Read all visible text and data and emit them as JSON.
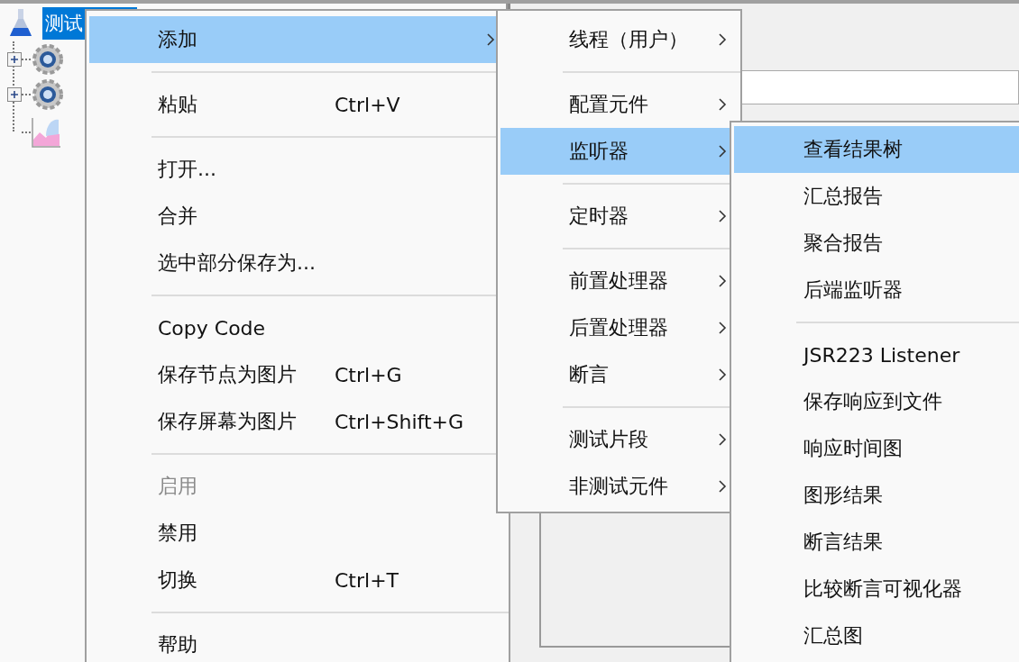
{
  "tree": {
    "root": {
      "label": "测试",
      "selected": true,
      "children": [
        {
          "kind": "gear",
          "expanded": false
        },
        {
          "kind": "gear",
          "expanded": false
        },
        {
          "kind": "chart"
        }
      ]
    }
  },
  "menus": [
    {
      "items": [
        {
          "kind": "item",
          "label": "添加",
          "submenu": true,
          "selected": true
        },
        {
          "kind": "separator"
        },
        {
          "kind": "item",
          "label": "粘贴",
          "shortcut": "Ctrl+V",
          "selected": false
        },
        {
          "kind": "separator"
        },
        {
          "kind": "item",
          "label": "打开...",
          "selected": false
        },
        {
          "kind": "item",
          "label": "合并",
          "selected": false
        },
        {
          "kind": "item",
          "label": "选中部分保存为...",
          "selected": false
        },
        {
          "kind": "separator"
        },
        {
          "kind": "item",
          "label": "Copy Code",
          "selected": false
        },
        {
          "kind": "item",
          "label": "保存节点为图片",
          "shortcut": "Ctrl+G",
          "selected": false
        },
        {
          "kind": "item",
          "label": "保存屏幕为图片",
          "shortcut": "Ctrl+Shift+G",
          "selected": false
        },
        {
          "kind": "separator"
        },
        {
          "kind": "item",
          "label": "启用",
          "disabled": true,
          "selected": false
        },
        {
          "kind": "item",
          "label": "禁用",
          "selected": false
        },
        {
          "kind": "item",
          "label": "切换",
          "shortcut": "Ctrl+T",
          "selected": false
        },
        {
          "kind": "separator"
        },
        {
          "kind": "item",
          "label": "帮助",
          "selected": false
        }
      ]
    },
    {
      "items": [
        {
          "kind": "item",
          "label": "线程（用户）",
          "submenu": true,
          "selected": false
        },
        {
          "kind": "separator"
        },
        {
          "kind": "item",
          "label": "配置元件",
          "submenu": true,
          "selected": false
        },
        {
          "kind": "item",
          "label": "监听器",
          "submenu": true,
          "selected": true
        },
        {
          "kind": "separator"
        },
        {
          "kind": "item",
          "label": "定时器",
          "submenu": true,
          "selected": false
        },
        {
          "kind": "separator"
        },
        {
          "kind": "item",
          "label": "前置处理器",
          "submenu": true,
          "selected": false
        },
        {
          "kind": "item",
          "label": "后置处理器",
          "submenu": true,
          "selected": false
        },
        {
          "kind": "item",
          "label": "断言",
          "submenu": true,
          "selected": false
        },
        {
          "kind": "separator"
        },
        {
          "kind": "item",
          "label": "测试片段",
          "submenu": true,
          "selected": false
        },
        {
          "kind": "item",
          "label": "非测试元件",
          "submenu": true,
          "selected": false
        }
      ]
    },
    {
      "items": [
        {
          "kind": "item",
          "label": "查看结果树",
          "selected": true
        },
        {
          "kind": "item",
          "label": "汇总报告",
          "selected": false
        },
        {
          "kind": "item",
          "label": "聚合报告",
          "selected": false
        },
        {
          "kind": "item",
          "label": "后端监听器",
          "selected": false
        },
        {
          "kind": "separator"
        },
        {
          "kind": "item",
          "label": "JSR223 Listener",
          "selected": false
        },
        {
          "kind": "item",
          "label": "保存响应到文件",
          "selected": false
        },
        {
          "kind": "item",
          "label": "响应时间图",
          "selected": false
        },
        {
          "kind": "item",
          "label": "图形结果",
          "selected": false
        },
        {
          "kind": "item",
          "label": "断言结果",
          "selected": false
        },
        {
          "kind": "item",
          "label": "比较断言可视化器",
          "selected": false
        },
        {
          "kind": "item",
          "label": "汇总图",
          "selected": false
        }
      ]
    }
  ]
}
